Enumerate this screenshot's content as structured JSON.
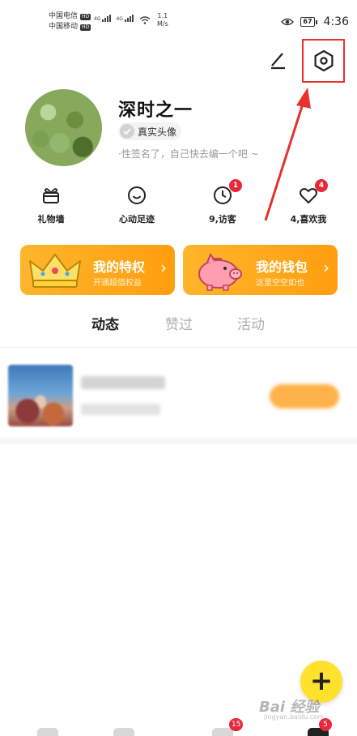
{
  "status_bar": {
    "carrier_1": "中国电信",
    "carrier_2": "中国移动",
    "hd_label": "HD",
    "net_1": "4G",
    "net_2": "4G",
    "speed_value": "1.1",
    "speed_unit": "M/s",
    "battery": "67",
    "time": "4:36"
  },
  "header": {
    "edit_icon": "edit-slash-icon",
    "settings_icon": "hexagon-settings-icon"
  },
  "profile": {
    "nickname": "深时之一",
    "real_avatar_label": "真实头像",
    "bio": "·性签名了，自己快去编一个吧 ~"
  },
  "stats": [
    {
      "label": "礼物墙",
      "icon": "gift-icon",
      "badge": ""
    },
    {
      "label": "心动足迹",
      "icon": "smile-icon",
      "badge": ""
    },
    {
      "label": "9,访客",
      "icon": "clock-icon",
      "badge": "1"
    },
    {
      "label": "4,喜欢我",
      "icon": "heart-icon",
      "badge": "4"
    }
  ],
  "cards": {
    "privilege": {
      "title": "我的特权",
      "subtitle": "开通超值权益",
      "icon": "crown-icon"
    },
    "wallet": {
      "title": "我的钱包",
      "subtitle": "这里空空如也",
      "icon": "piggy-bank-icon"
    }
  },
  "tabs": [
    {
      "label": "动态",
      "active": true
    },
    {
      "label": "赞过",
      "active": false
    },
    {
      "label": "活动",
      "active": false
    }
  ],
  "fab": {
    "label": "+"
  },
  "bottom_nav": {
    "badge_messages": "15",
    "badge_me": "5"
  },
  "watermark": {
    "text": "Bai 经验",
    "sub": "jingyan.baidu.com"
  },
  "colors": {
    "accent": "#ffa51a",
    "badge": "#e8283a",
    "fab": "#ffe12e",
    "annotation": "#e5322d"
  }
}
